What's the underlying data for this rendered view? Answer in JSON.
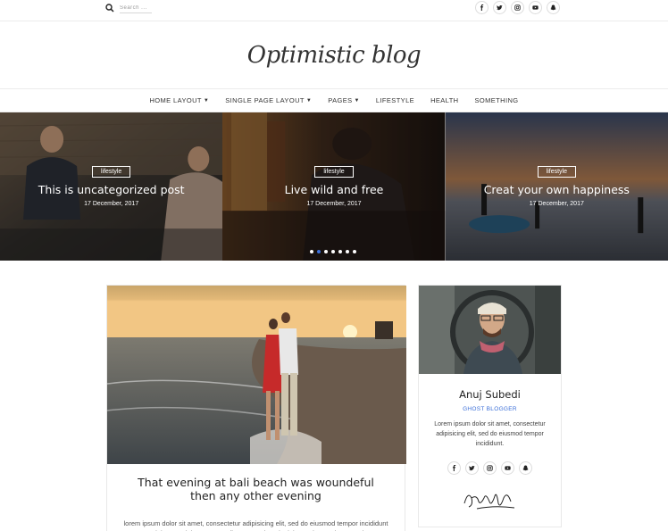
{
  "search": {
    "placeholder": "Search ..."
  },
  "social_icons": [
    "facebook-icon",
    "twitter-icon",
    "instagram-icon",
    "youtube-icon",
    "snapchat-icon"
  ],
  "logo": {
    "text": "Optimistic blog"
  },
  "nav": {
    "items": [
      {
        "label": "HOME LAYOUT",
        "dropdown": true
      },
      {
        "label": "SINGLE PAGE LAYOUT",
        "dropdown": true
      },
      {
        "label": "PAGES",
        "dropdown": true
      },
      {
        "label": "LIFESTYLE",
        "dropdown": false
      },
      {
        "label": "HEALTH",
        "dropdown": false
      },
      {
        "label": "SOMETHING",
        "dropdown": false
      }
    ]
  },
  "slides": [
    {
      "category": "lifestyle",
      "title": "This is uncategorized post",
      "date": "17 December, 2017"
    },
    {
      "category": "lifestyle",
      "title": "Live wild and free",
      "date": "17 December, 2017"
    },
    {
      "category": "lifestyle",
      "title": "Creat your own happiness",
      "date": "17 December, 2017"
    }
  ],
  "slider_dots": {
    "count": 7,
    "active_index": 1
  },
  "post": {
    "title": "That evening at bali beach was woundeful then any other evening",
    "excerpt": "lorem ipsum dolor sit amet, consectetur adipisicing elit, sed do eiusmod tempor incididunt ut labore et dolore magna aliqua. Ut enim ad minim veniam, quis nostrud"
  },
  "author": {
    "name": "Anuj Subedi",
    "role": "GHOST BLOGGER",
    "bio": "Lorem ipsum dolor sit amet, consectetur adipisicing elit, sed do eiusmod tempor incididunt."
  },
  "colors": {
    "accent": "#3b6fd8",
    "border": "#ececec",
    "text": "#222222"
  }
}
